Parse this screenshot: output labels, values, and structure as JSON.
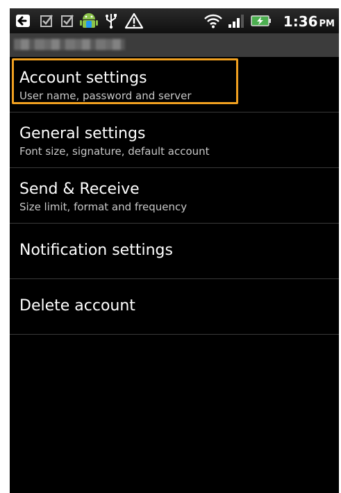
{
  "status_bar": {
    "time": "1:36",
    "ampm": "PM",
    "icons": [
      "back-notification-icon",
      "checkbox-notification-icon",
      "checkbox-notification-icon",
      "android-notification-icon",
      "usb-icon",
      "warning-icon",
      "wifi-icon",
      "signal-icon",
      "battery-charging-icon"
    ],
    "battery_color": "#4caf50"
  },
  "title_bar": {
    "account_name": ""
  },
  "settings": {
    "items": [
      {
        "title": "Account settings",
        "summary": "User name, password and server",
        "highlighted": true
      },
      {
        "title": "General settings",
        "summary": "Font size, signature, default account"
      },
      {
        "title": "Send & Receive",
        "summary": "Size limit, format and frequency"
      },
      {
        "title": "Notification settings",
        "summary": ""
      },
      {
        "title": "Delete account",
        "summary": ""
      }
    ]
  },
  "colors": {
    "highlight": "#f0a020",
    "background": "#000000",
    "divider": "#3a3a3a"
  }
}
